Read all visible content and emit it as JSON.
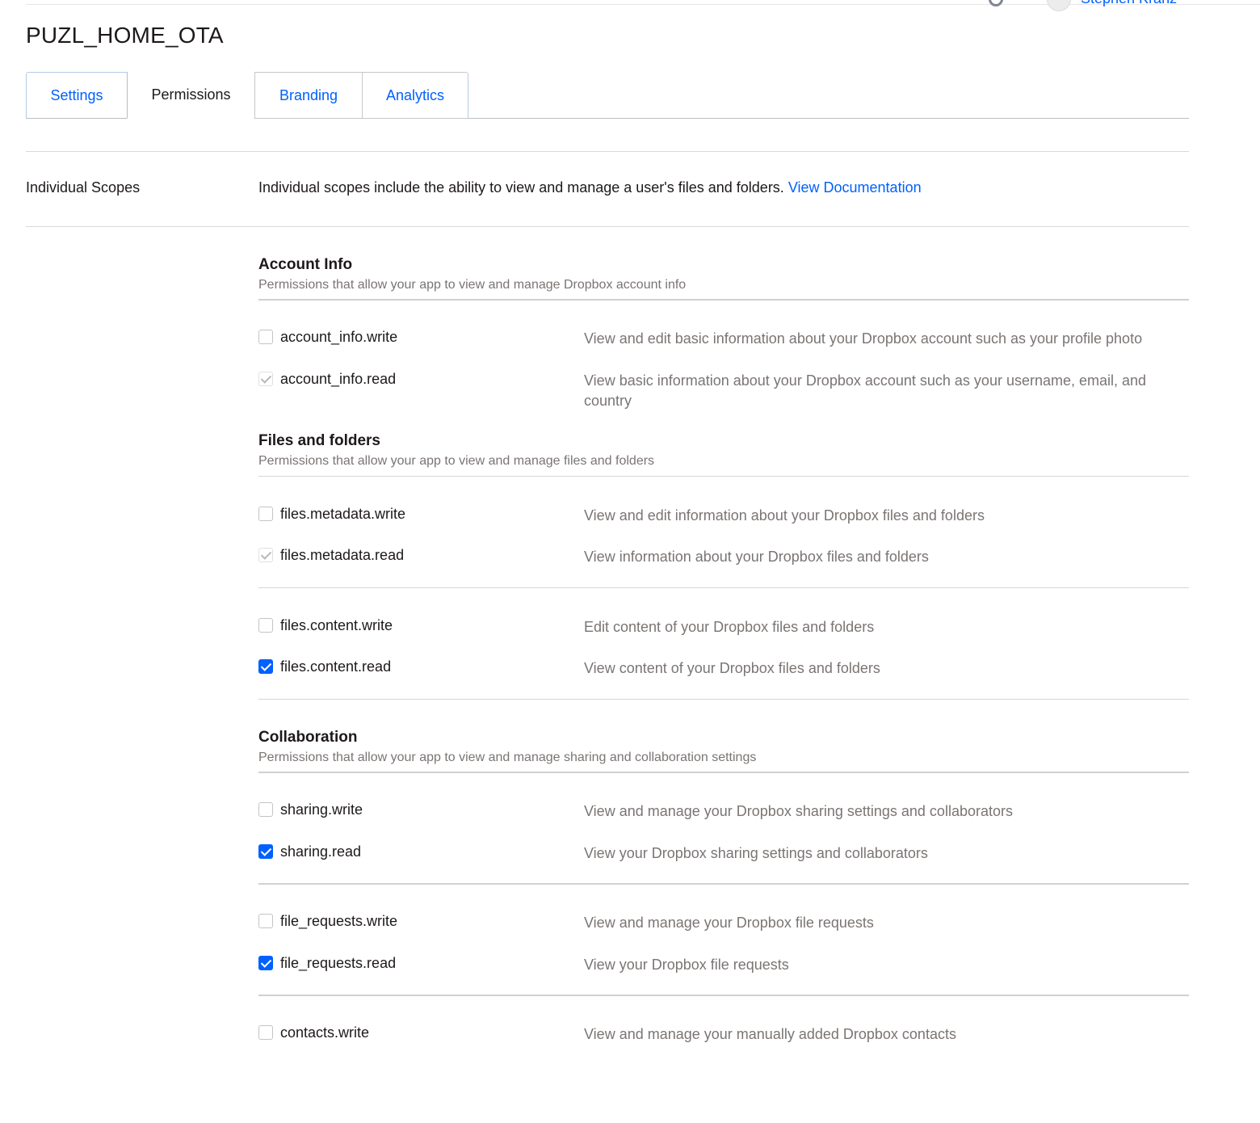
{
  "header": {
    "title": "PUZL_HOME_OTA",
    "user_name": "Stephen Kranz"
  },
  "tabs": [
    {
      "label": "Settings",
      "active": false
    },
    {
      "label": "Permissions",
      "active": true
    },
    {
      "label": "Branding",
      "active": false
    },
    {
      "label": "Analytics",
      "active": false
    }
  ],
  "scopes": {
    "label": "Individual Scopes",
    "description": "Individual scopes include the ability to view and manage a user's files and folders.",
    "doc_link": "View Documentation"
  },
  "groups": {
    "account_info": {
      "title": "Account Info",
      "subtitle": "Permissions that allow your app to view and manage Dropbox account info"
    },
    "files": {
      "title": "Files and folders",
      "subtitle": "Permissions that allow your app to view and manage files and folders"
    },
    "collaboration": {
      "title": "Collaboration",
      "subtitle": "Permissions that allow your app to view and manage sharing and collaboration settings"
    }
  },
  "permissions": [
    {
      "name": "account_info.write",
      "desc": "View and edit basic information about your Dropbox account such as your profile photo",
      "state": "unchecked"
    },
    {
      "name": "account_info.read",
      "desc": "View basic information about your Dropbox account such as your username, email, and country",
      "state": "checked-disabled"
    },
    {
      "name": "files.metadata.write",
      "desc": "View and edit information about your Dropbox files and folders",
      "state": "unchecked"
    },
    {
      "name": "files.metadata.read",
      "desc": "View information about your Dropbox files and folders",
      "state": "checked-disabled"
    },
    {
      "name": "files.content.write",
      "desc": "Edit content of your Dropbox files and folders",
      "state": "unchecked"
    },
    {
      "name": "files.content.read",
      "desc": "View content of your Dropbox files and folders",
      "state": "checked"
    },
    {
      "name": "sharing.write",
      "desc": "View and manage your Dropbox sharing settings and collaborators",
      "state": "unchecked"
    },
    {
      "name": "sharing.read",
      "desc": "View your Dropbox sharing settings and collaborators",
      "state": "checked"
    },
    {
      "name": "file_requests.write",
      "desc": "View and manage your Dropbox file requests",
      "state": "unchecked"
    },
    {
      "name": "file_requests.read",
      "desc": "View your Dropbox file requests",
      "state": "checked"
    },
    {
      "name": "contacts.write",
      "desc": "View and manage your manually added Dropbox contacts",
      "state": "unchecked"
    }
  ],
  "colors": {
    "link": "#0061fe",
    "checkbox_checked": "#0061fe",
    "muted_text": "#7a7573"
  }
}
